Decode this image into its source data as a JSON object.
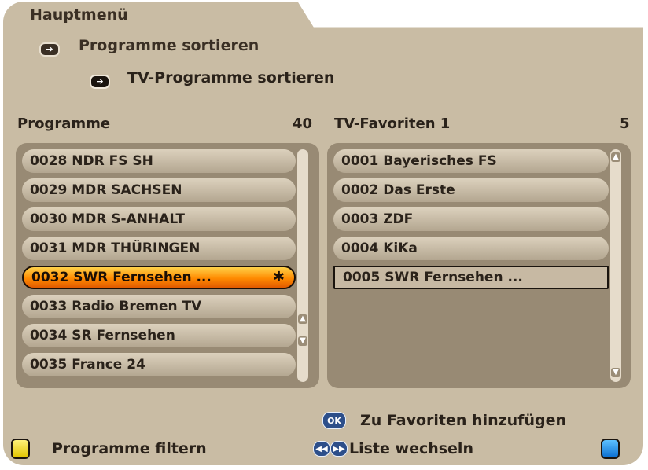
{
  "breadcrumb": {
    "root": "Hauptmenü",
    "level1": "Programme sortieren",
    "level2": "TV-Programme sortieren"
  },
  "left_list": {
    "title": "Programme",
    "count": "40",
    "items": [
      "0028  NDR FS SH",
      "0029  MDR SACHSEN",
      "0030  MDR S-ANHALT",
      "0031  MDR THÜRINGEN",
      "0032  SWR Fernsehen ...",
      "0033  Radio Bremen TV",
      "0034  SR Fernsehen",
      "0035  France 24"
    ],
    "selected_index": 4
  },
  "right_list": {
    "title": "TV-Favoriten 1",
    "count": "5",
    "items": [
      "0001  Bayerisches FS",
      "0002  Das Erste",
      "0003  ZDF",
      "0004  KiKa",
      "0005  SWR Fernsehen ..."
    ],
    "cursor_index": 4
  },
  "footer": {
    "ok_button": "OK",
    "add_favorites": "Zu Favoriten hinzufügen",
    "filter": "Programme filtern",
    "switch_list": "Liste wechseln"
  },
  "icons": {
    "arrow": "arrow-right-icon",
    "star": "star-icon",
    "scroll_up": "scroll-up-icon",
    "scroll_down": "scroll-down-icon"
  },
  "colors": {
    "panel": "#c9bca4",
    "list_bg": "#988a74",
    "highlight": "#ff8a00",
    "yellow": "#e2c400",
    "blue": "#0b6fd0"
  }
}
